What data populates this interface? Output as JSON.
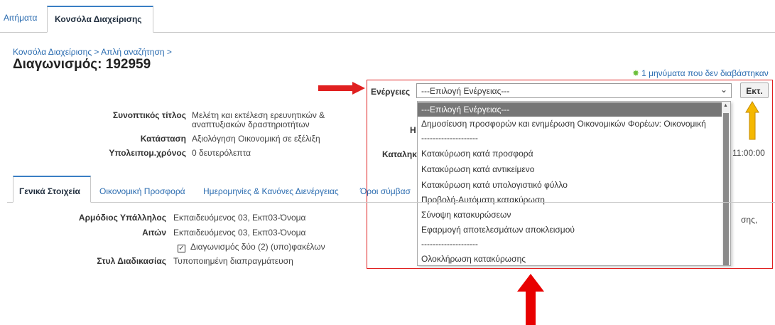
{
  "top_tabs": {
    "requests": "Αιτήματα",
    "console": "Κονσόλα Διαχείρισης"
  },
  "breadcrumb": "Κονσόλα Διαχείρισης  >  Απλή αναζήτηση  >",
  "page_title": "Διαγωνισμός: 192959",
  "messages": "1 μηνύματα που δεν διαβάστηκαν",
  "summary": {
    "title_label": "Συνοπτικός τίτλος",
    "title_value_1": "Μελέτη και εκτέλεση ερευνητικών &",
    "title_value_2": "αναπτυξιακών δραστηριοτήτων",
    "status_label": "Κατάσταση",
    "status_value": "Αξιολόγηση Οικονομική σε εξέλιξη",
    "remaining_label": "Υπολειπομ.χρόνος",
    "remaining_value": "0 δευτερόλεπτα",
    "partial_label_h": "Η",
    "partial_deadline_label": "Καταληκ",
    "partial_time": "11:00:00",
    "partial_right": "σης,"
  },
  "actions": {
    "label": "Ενέργειες",
    "selected": "---Επιλογή Ενέργειας---",
    "go_button": "Εκτ.",
    "options": [
      "---Επιλογή Ενέργειας---",
      "Δημοσίευση προσφορών και ενημέρωση Οικονομικών Φορέων: Οικονομική",
      "--------------------",
      "Κατακύρωση κατά προσφορά",
      "Κατακύρωση κατά αντικείμενο",
      "Κατακύρωση κατά υπολογιστικό φύλλο",
      "Προβολή-Αυτόματη κατακύρωση",
      "Σύνοψη κατακυρώσεων",
      "Εφαρμογή αποτελεσμάτων αποκλεισμού",
      "--------------------",
      "Ολοκλήρωση κατακύρωσης"
    ]
  },
  "section_tabs": {
    "general": "Γενικά Στοιχεία",
    "financial": "Οικονομική Προσφορά",
    "dates": "Ημερομηνίες & Κανόνες Διενέργειας",
    "terms": "Όροι σύμβασ"
  },
  "details": {
    "officer_label": "Αρμόδιος Υπάλληλος",
    "officer_value": "Εκπαιδευόμενος 03, Εκπ03-Όνομα",
    "requester_label": "Αιτών",
    "requester_value": "Εκπαιδευόμενος 03, Εκπ03-Όνομα",
    "two_envelopes": "Διαγωνισμός δύο (2) (υπο)φακέλων",
    "style_label": "Στυλ Διαδικασίας",
    "style_value": "Τυποποιημένη διαπραγμάτευση"
  },
  "colors": {
    "link": "#2b6cb0",
    "highlight": "#e02020",
    "arrow_yellow": "#f5b800",
    "selected_option": "#767676"
  },
  "icons": {
    "messages": "gear-star-icon",
    "dropdown": "chevron-down-icon"
  }
}
